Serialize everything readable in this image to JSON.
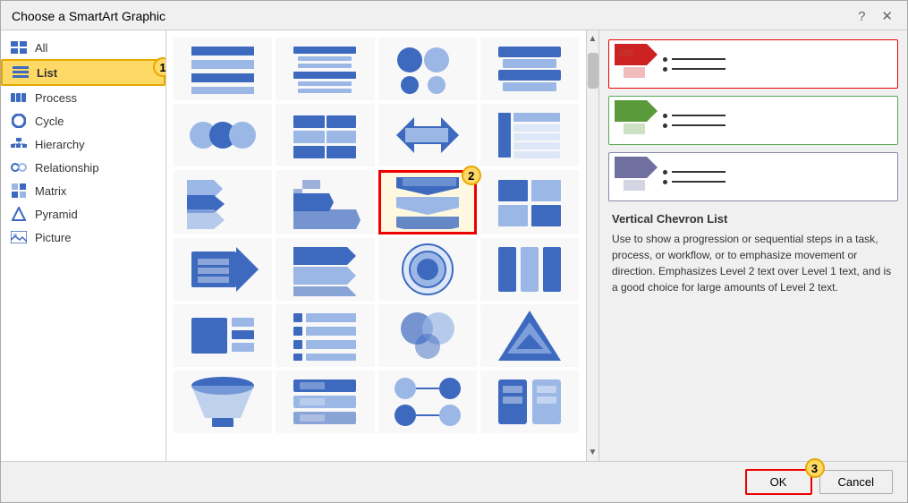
{
  "dialog": {
    "title": "Choose a SmartArt Graphic",
    "help_btn": "?",
    "close_btn": "✕"
  },
  "sidebar": {
    "items": [
      {
        "id": "all",
        "label": "All",
        "icon": "grid-icon",
        "active": false
      },
      {
        "id": "list",
        "label": "List",
        "icon": "list-icon",
        "active": true
      },
      {
        "id": "process",
        "label": "Process",
        "icon": "process-icon",
        "active": false
      },
      {
        "id": "cycle",
        "label": "Cycle",
        "icon": "cycle-icon",
        "active": false
      },
      {
        "id": "hierarchy",
        "label": "Hierarchy",
        "icon": "hierarchy-icon",
        "active": false
      },
      {
        "id": "relationship",
        "label": "Relationship",
        "icon": "relationship-icon",
        "active": false
      },
      {
        "id": "matrix",
        "label": "Matrix",
        "icon": "matrix-icon",
        "active": false
      },
      {
        "id": "pyramid",
        "label": "Pyramid",
        "icon": "pyramid-icon",
        "active": false
      },
      {
        "id": "picture",
        "label": "Picture",
        "icon": "picture-icon",
        "active": false
      }
    ]
  },
  "badges": {
    "b1": "1",
    "b2": "2",
    "b3": "3"
  },
  "right_panel": {
    "preview_items": [
      {
        "color": "red",
        "hex": "#cc2222"
      },
      {
        "color": "green",
        "hex": "#5a9a3a"
      },
      {
        "color": "purple",
        "hex": "#7070a0"
      }
    ],
    "title": "Vertical Chevron List",
    "description": "Use to show a progression or sequential steps in a task, process, or workflow, or to emphasize movement or direction. Emphasizes Level 2 text over Level 1 text, and is a good choice for large amounts of Level 2 text."
  },
  "buttons": {
    "ok": "OK",
    "cancel": "Cancel"
  }
}
